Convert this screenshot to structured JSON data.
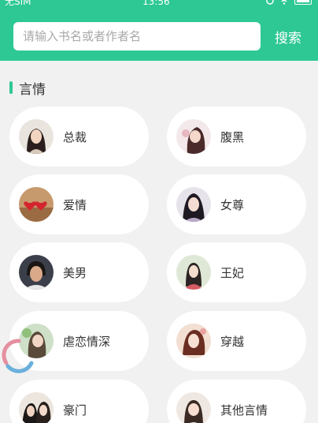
{
  "status_bar": {
    "carrier": "无SIM",
    "time": "13:56"
  },
  "search": {
    "placeholder": "请输入书名或者作者名",
    "button_label": "搜索"
  },
  "section": {
    "title": "言情"
  },
  "categories": [
    {
      "label": "总裁",
      "avatar": "woman-portrait-icon"
    },
    {
      "label": "腹黑",
      "avatar": "woman-portrait-icon"
    },
    {
      "label": "爱情",
      "avatar": "hearts-icon"
    },
    {
      "label": "女尊",
      "avatar": "woman-portrait-icon"
    },
    {
      "label": "美男",
      "avatar": "man-portrait-icon"
    },
    {
      "label": "王妃",
      "avatar": "woman-portrait-icon"
    },
    {
      "label": "虐恋情深",
      "avatar": "woman-portrait-icon"
    },
    {
      "label": "穿越",
      "avatar": "woman-portrait-icon"
    },
    {
      "label": "豪门",
      "avatar": "couple-portrait-icon"
    },
    {
      "label": "其他言情",
      "avatar": "woman-portrait-icon"
    }
  ],
  "colors": {
    "accent": "#2dc893",
    "background": "#f1f1f1",
    "pill": "#ffffff"
  }
}
